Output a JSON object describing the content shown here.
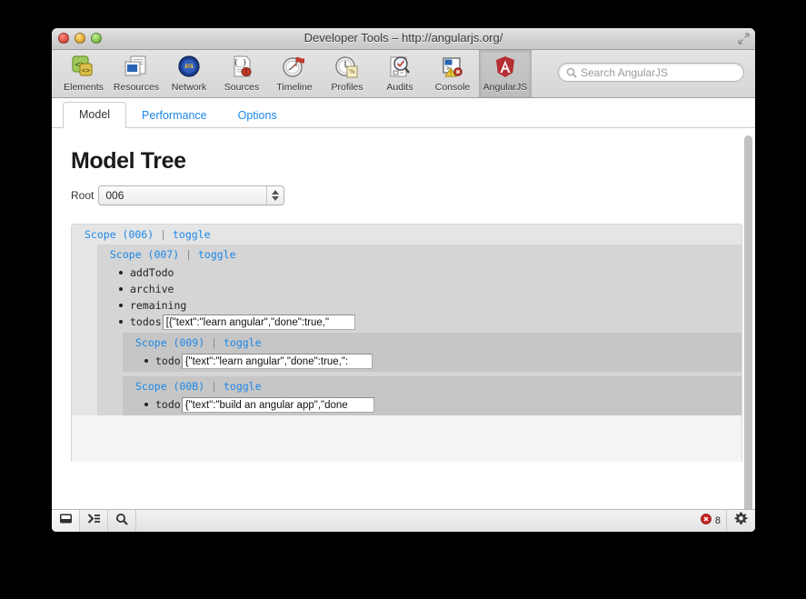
{
  "window": {
    "title": "Developer Tools – http://angularjs.org/",
    "lights": [
      "close-button",
      "minimize-button",
      "zoom-button"
    ]
  },
  "toolbar": {
    "items": [
      {
        "label": "Elements",
        "icon": "elements-icon",
        "active": false
      },
      {
        "label": "Resources",
        "icon": "resources-icon",
        "active": false
      },
      {
        "label": "Network",
        "icon": "network-icon",
        "active": false
      },
      {
        "label": "Sources",
        "icon": "sources-icon",
        "active": false
      },
      {
        "label": "Timeline",
        "icon": "timeline-icon",
        "active": false
      },
      {
        "label": "Profiles",
        "icon": "profiles-icon",
        "active": false
      },
      {
        "label": "Audits",
        "icon": "audits-icon",
        "active": false
      },
      {
        "label": "Console",
        "icon": "console-icon",
        "active": false
      },
      {
        "label": "AngularJS",
        "icon": "angularjs-icon",
        "active": true
      }
    ],
    "search": {
      "placeholder": "Search AngularJS",
      "value": ""
    }
  },
  "panel": {
    "tabs": [
      {
        "label": "Model",
        "active": true
      },
      {
        "label": "Performance",
        "active": false
      },
      {
        "label": "Options",
        "active": false
      }
    ],
    "heading": "Model Tree",
    "root": {
      "label": "Root",
      "value": "006"
    }
  },
  "tree": {
    "toggle_label": "toggle",
    "separator": "|",
    "nodes": [
      {
        "scope_label": "Scope (006)",
        "level": 0,
        "props": []
      },
      {
        "scope_label": "Scope (007)",
        "level": 1,
        "props": [
          {
            "name": "addTodo",
            "value": null
          },
          {
            "name": "archive",
            "value": null
          },
          {
            "name": "remaining",
            "value": null
          },
          {
            "name": "todos",
            "value": "[{\"text\":\"learn angular\",\"done\":true,\""
          }
        ]
      },
      {
        "scope_label": "Scope (009)",
        "level": 2,
        "props": [
          {
            "name": "todo",
            "value": "{\"text\":\"learn angular\",\"done\":true,\":"
          }
        ]
      },
      {
        "scope_label": "Scope (00B)",
        "level": 2,
        "props": [
          {
            "name": "todo",
            "value": "{\"text\":\"build an angular app\",\"done"
          }
        ]
      }
    ]
  },
  "statusbar": {
    "buttons": [
      {
        "icon": "dock-panel-icon"
      },
      {
        "icon": "console-prompt-icon"
      },
      {
        "icon": "search-icon"
      }
    ],
    "error_count": "8",
    "settings_icon": "gear-icon"
  },
  "colors": {
    "link": "#1a87e8",
    "error_red": "#cc2222",
    "angular_red": "#b52e31"
  }
}
